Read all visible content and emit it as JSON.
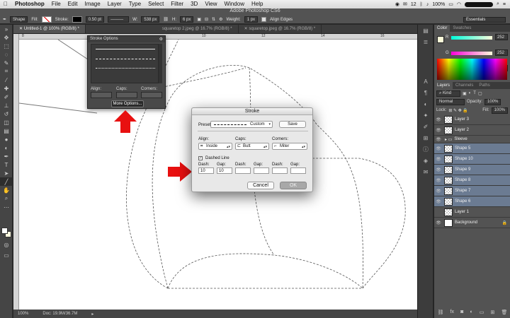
{
  "menubar": {
    "app": "Photoshop",
    "items": [
      "File",
      "Edit",
      "Image",
      "Layer",
      "Type",
      "Select",
      "Filter",
      "3D",
      "View",
      "Window",
      "Help"
    ],
    "battery": "100%",
    "notifications": "12"
  },
  "optbar": {
    "window_title": "Adobe Photoshop CS6",
    "shape_mode": "Shape",
    "fill_label": "Fill:",
    "stroke_label": "Stroke:",
    "stroke_width": "0.50 pt",
    "w_label": "W:",
    "w_value": "538 px",
    "h_label": "H:",
    "h_value": "6 px",
    "weight_label": "Weight:",
    "weight_value": "1 px",
    "align_edges": "Align Edges",
    "workspace": "Essentials"
  },
  "tabs": [
    {
      "label": "Untitled-1 @ 100% (RGB/8) *",
      "active": true
    },
    {
      "label": "squaretop 2.jpeg @ 16.7% (RGB/8) *",
      "active": false
    },
    {
      "label": "squaretop.jpeg @ 16.7% (RGB/8) *",
      "active": false
    }
  ],
  "ruler": {
    "marks": [
      "8",
      "10",
      "12",
      "14",
      "16"
    ]
  },
  "status": {
    "zoom": "100%",
    "doc": "Doc: 19.9M/36.7M"
  },
  "color_panel": {
    "tabs": [
      "Color",
      "Swatches"
    ],
    "r_label": "R",
    "r_value": "252",
    "g_label": "G",
    "g_value": "252",
    "b_label": "B",
    "b_value": "218"
  },
  "layers_panel": {
    "tabs": [
      "Layers",
      "Channels",
      "Paths"
    ],
    "kind": "Kind",
    "blend": "Normal",
    "opacity_label": "Opacity:",
    "opacity": "100%",
    "lock_label": "Lock:",
    "fill_label": "Fill:",
    "fill": "100%",
    "layers": [
      {
        "name": "Layer 3",
        "selected": false
      },
      {
        "name": "Layer 2",
        "selected": false
      },
      {
        "name": "Sleeve",
        "selected": false,
        "group": true
      },
      {
        "name": "Shape 5",
        "selected": true
      },
      {
        "name": "Shape 10",
        "selected": true
      },
      {
        "name": "Shape 9",
        "selected": true
      },
      {
        "name": "Shape 8",
        "selected": true
      },
      {
        "name": "Shape 7",
        "selected": true
      },
      {
        "name": "Shape 6",
        "selected": true
      },
      {
        "name": "Layer 1",
        "selected": false
      },
      {
        "name": "Background",
        "selected": false
      }
    ]
  },
  "stroke_options": {
    "title": "Stroke Options",
    "align_label": "Align:",
    "caps_label": "Caps:",
    "corners_label": "Corners:",
    "more_button": "More Options..."
  },
  "stroke_dialog": {
    "title": "Stroke",
    "preset_label": "Preset:",
    "preset_value": "Custom",
    "save_button": "Save",
    "align_label": "Align:",
    "align_value": "Inside",
    "caps_label": "Caps:",
    "caps_value": "Butt",
    "corners_label": "Corners:",
    "corners_value": "Miter",
    "dashed_line_label": "Dashed Line",
    "dashed_checked": "✓",
    "dash_labels": [
      "Dash:",
      "Gap:",
      "Dash:",
      "Gap:",
      "Dash:",
      "Gap:"
    ],
    "dash_values": [
      "10",
      "10",
      "",
      "",
      "",
      ""
    ],
    "cancel_button": "Cancel",
    "ok_button": "OK"
  },
  "colors": {
    "arrow": "#e81010",
    "selected_layer": "#6b7b92"
  }
}
